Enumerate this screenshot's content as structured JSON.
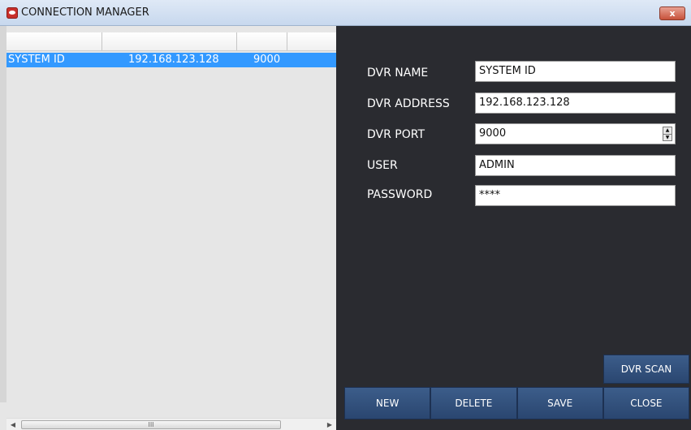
{
  "window": {
    "title": "CONNECTION MANAGER",
    "close_label": "x"
  },
  "list": {
    "rows": [
      {
        "name": "SYSTEM ID",
        "address": "192.168.123.128",
        "port": "9000"
      }
    ],
    "scroll_thumb_label": "III"
  },
  "form": {
    "name_label": "DVR NAME",
    "name_value": "SYSTEM ID",
    "address_label": "DVR ADDRESS",
    "address_value": "192.168.123.128",
    "port_label": "DVR PORT",
    "port_value": "9000",
    "user_label": "USER",
    "user_value": "ADMIN",
    "password_label": "PASSWORD",
    "password_value": "****"
  },
  "buttons": {
    "scan": "DVR SCAN",
    "new": "NEW",
    "delete": "DELETE",
    "save": "SAVE",
    "close": "CLOSE"
  },
  "colors": {
    "selection": "#3399ff",
    "panel_dark": "#2a2b30",
    "button": "#2f4d78"
  }
}
